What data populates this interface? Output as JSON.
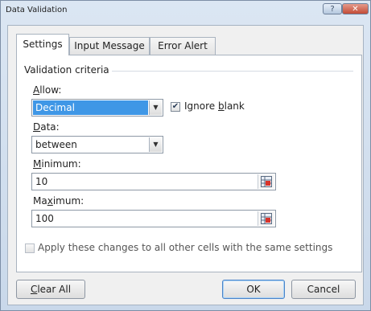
{
  "window": {
    "title": "Data Validation",
    "help_label": "?",
    "close_label": "✕"
  },
  "tabs": [
    {
      "label": "Settings",
      "active": true
    },
    {
      "label": "Input Message",
      "active": false
    },
    {
      "label": "Error Alert",
      "active": false
    }
  ],
  "criteria": {
    "group_label": "Validation criteria",
    "allow": {
      "label_pre": "",
      "label_accel": "A",
      "label_post": "llow:",
      "value": "Decimal"
    },
    "ignore_blank": {
      "checked": true,
      "label_pre": "Ignore ",
      "label_accel": "b",
      "label_post": "lank"
    },
    "data": {
      "label_pre": "",
      "label_accel": "D",
      "label_post": "ata:",
      "value": "between"
    },
    "minimum": {
      "label_pre": "",
      "label_accel": "M",
      "label_post": "inimum:",
      "value": "10"
    },
    "maximum": {
      "label_pre": "Ma",
      "label_accel": "x",
      "label_post": "imum:",
      "value": "100"
    }
  },
  "apply_all": {
    "checked": false,
    "label": "Apply these changes to all other cells with the same settings"
  },
  "buttons": {
    "clear_all": {
      "label_accel": "C",
      "label_post": "lear All"
    },
    "ok": "OK",
    "cancel": "Cancel"
  },
  "icons": {
    "dropdown": "chevron-down-icon",
    "range_select": "range-select-icon",
    "check": "checkmark-icon"
  }
}
